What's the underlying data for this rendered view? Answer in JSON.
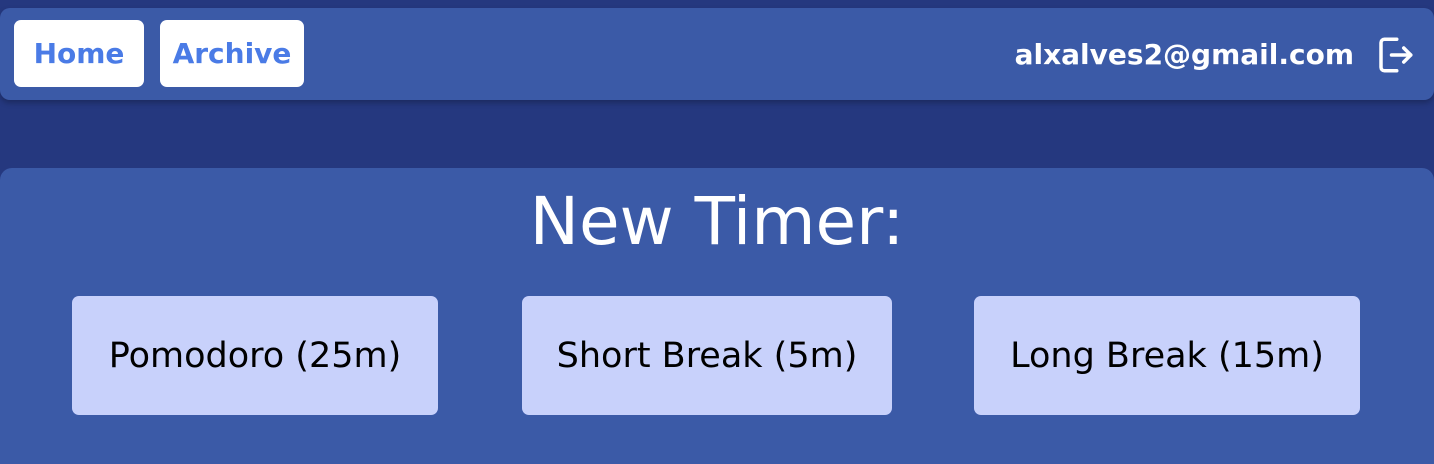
{
  "header": {
    "nav": {
      "home_label": "Home",
      "archive_label": "Archive"
    },
    "user_email": "alxalves2@gmail.com",
    "logout_icon": "logout-icon"
  },
  "main": {
    "title": "New Timer:",
    "timers": [
      {
        "label": "Pomodoro (25m)"
      },
      {
        "label": "Short Break (5m)"
      },
      {
        "label": "Long Break (15m)"
      }
    ]
  },
  "colors": {
    "page_background": "#25387f",
    "panel_background": "#3b5aa7",
    "nav_button_text": "#4a7be6",
    "timer_button_background": "#c8d1fb"
  }
}
